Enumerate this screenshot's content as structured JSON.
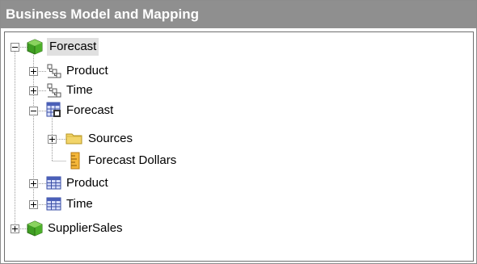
{
  "panel": {
    "title": "Business Model and Mapping"
  },
  "tree": {
    "root_forecast": {
      "label": "Forecast",
      "icon": "green-cube-icon",
      "expanded": true,
      "selected": true
    },
    "dim_product": {
      "label": "Product",
      "icon": "hierarchy-icon",
      "expanded": false
    },
    "dim_time": {
      "label": "Time",
      "icon": "hierarchy-icon",
      "expanded": false
    },
    "fact_forecast": {
      "label": "Forecast",
      "icon": "fact-table-icon",
      "expanded": true
    },
    "sources": {
      "label": "Sources",
      "icon": "folder-icon",
      "expanded": false
    },
    "forecast_dollars": {
      "label": "Forecast Dollars",
      "icon": "measure-icon"
    },
    "tbl_product": {
      "label": "Product",
      "icon": "table-icon",
      "expanded": false
    },
    "tbl_time": {
      "label": "Time",
      "icon": "table-icon",
      "expanded": false
    },
    "root_suppliersales": {
      "label": "SupplierSales",
      "icon": "green-cube-icon",
      "expanded": false
    }
  },
  "colors": {
    "titlebar": "#8f8f8f",
    "selection": "#e0e0e0",
    "cube_green": "#4caf2a",
    "table_blue": "#4a5fb8",
    "folder_yellow": "#f2d56a",
    "measure_orange": "#e8a020"
  }
}
